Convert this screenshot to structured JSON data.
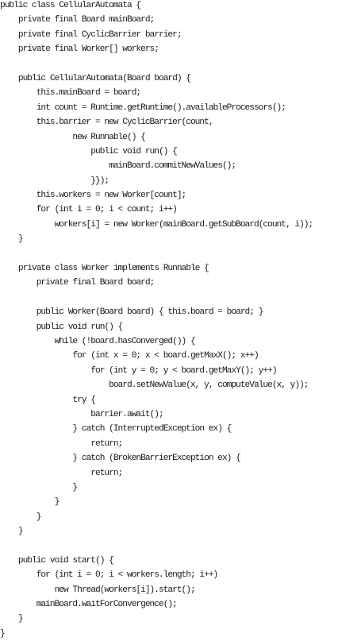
{
  "code": {
    "lines": [
      "public class CellularAutomata {",
      "    private final Board mainBoard;",
      "    private final CyclicBarrier barrier;",
      "    private final Worker[] workers;",
      "",
      "    public CellularAutomata(Board board) {",
      "        this.mainBoard = board;",
      "        int count = Runtime.getRuntime().availableProcessors();",
      "        this.barrier = new CyclicBarrier(count,",
      "                new Runnable() {",
      "                    public void run() {",
      "                        mainBoard.commitNewValues();",
      "                    }});",
      "        this.workers = new Worker[count];",
      "        for (int i = 0; i < count; i++)",
      "            workers[i] = new Worker(mainBoard.getSubBoard(count, i));",
      "    }",
      "",
      "    private class Worker implements Runnable {",
      "        private final Board board;",
      "",
      "        public Worker(Board board) { this.board = board; }",
      "        public void run() {",
      "            while (!board.hasConverged()) {",
      "                for (int x = 0; x < board.getMaxX(); x++)",
      "                    for (int y = 0; y < board.getMaxY(); y++)",
      "                        board.setNewValue(x, y, computeValue(x, y));",
      "                try {",
      "                    barrier.await();",
      "                } catch (InterruptedException ex) {",
      "                    return;",
      "                } catch (BrokenBarrierException ex) {",
      "                    return;",
      "                }",
      "            }",
      "        }",
      "    }",
      "",
      "    public void start() {",
      "        for (int i = 0; i < workers.length; i++)",
      "            new Thread(workers[i]).start();",
      "        mainBoard.waitForConvergence();",
      "    }",
      "}"
    ]
  }
}
